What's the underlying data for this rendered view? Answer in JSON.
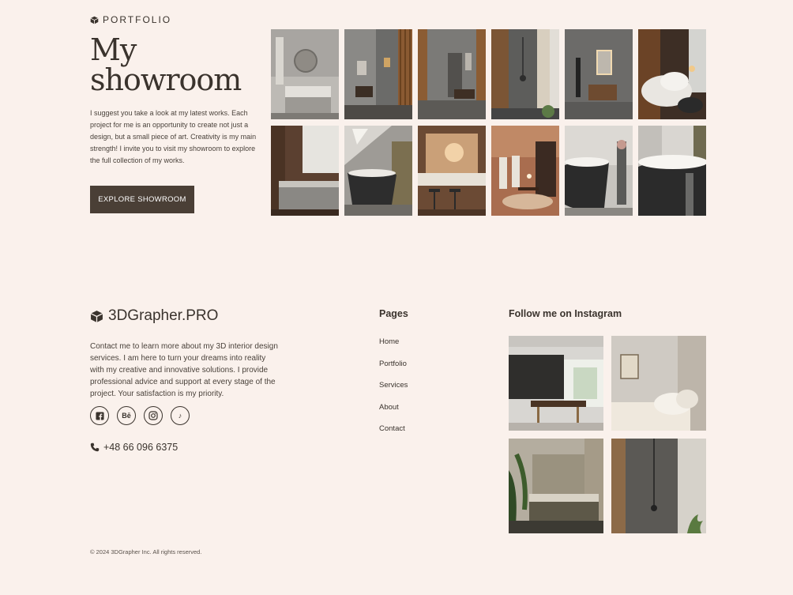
{
  "portfolio": {
    "eyebrow": "PORTFOLIO",
    "title_line1": "My",
    "title_line2": "showroom",
    "description": "I suggest you take a look at my latest works. Each project for me is an opportunity to create not just a design, but a small piece of art. Creativity is my main strength! I invite you to visit my showroom to explore the full collection of my works.",
    "button_label": "EXPLORE SHOWROOM",
    "gallery_icons": [
      "bathroom-mirror-image",
      "shower-wood-image",
      "bathroom-door-image",
      "shower-concrete-image",
      "bathroom-vanity-image",
      "bedroom-pillows-image",
      "bedroom-wood-image",
      "bathtub-skylight-image",
      "kitchen-bar-image",
      "dining-room-image",
      "bathtub-grey-image",
      "bathtub-closeup-image"
    ]
  },
  "footer": {
    "brand": "3DGrapher.PRO",
    "description": "Contact me to learn more about my 3D interior design services. I am here to turn your dreams into reality with my creative and innovative solutions. I provide professional advice and support at every stage of the project. Your satisfaction is my priority.",
    "socials": [
      {
        "icon": "facebook-icon",
        "glyph": "f"
      },
      {
        "icon": "behance-icon",
        "glyph": "Bē"
      },
      {
        "icon": "instagram-icon",
        "glyph": ""
      },
      {
        "icon": "tiktok-icon",
        "glyph": "♪"
      }
    ],
    "phone": "+48 66 096 6375",
    "pages_heading": "Pages",
    "pages": [
      "Home",
      "Portfolio",
      "Services",
      "About",
      "Contact"
    ],
    "instagram_heading": "Follow me on Instagram",
    "instagram_icons": [
      "kitchen-dining-image",
      "bedroom-light-image",
      "bedroom-plants-image",
      "shower-stone-image"
    ],
    "copyright": "© 2024 3DGrapher Inc. All rights reserved."
  },
  "colors": {
    "background": "#faf1ec",
    "text": "#3a332d",
    "button": "#4a3f36"
  }
}
